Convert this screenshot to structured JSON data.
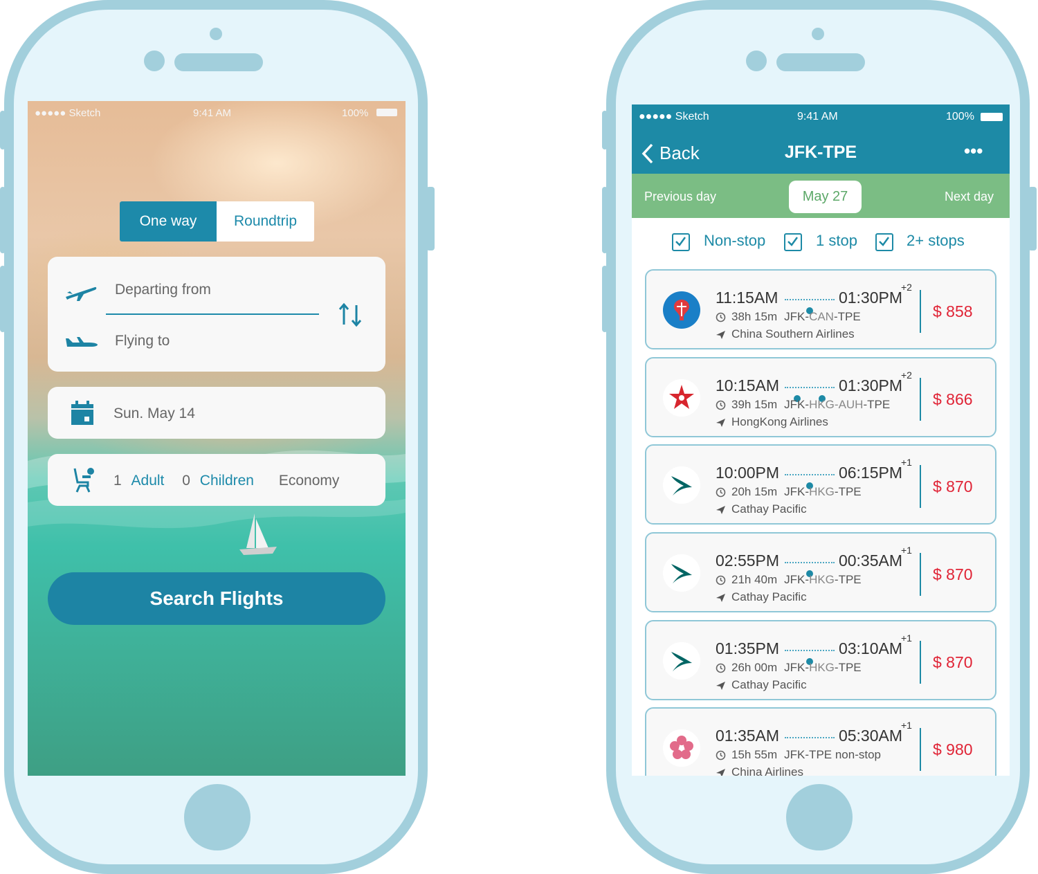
{
  "search_screen": {
    "status": {
      "carrier": "●●●●● Sketch",
      "time": "9:41 AM",
      "battery": "100%"
    },
    "trip_type": {
      "one_way": "One way",
      "roundtrip": "Roundtrip",
      "selected": "One way"
    },
    "route": {
      "departing_placeholder": "Departing from",
      "arriving_placeholder": "Flying to"
    },
    "date": "Sun. May 14",
    "passengers": {
      "adult_count": "1",
      "adult_label": "Adult",
      "children_count": "0",
      "children_label": "Children",
      "cabin": "Economy"
    },
    "search_button": "Search Flights"
  },
  "results_screen": {
    "status": {
      "carrier": "●●●●● Sketch",
      "time": "9:41 AM",
      "battery": "100%"
    },
    "nav": {
      "back": "Back",
      "title": "JFK-TPE",
      "more": "•••"
    },
    "day_nav": {
      "previous": "Previous day",
      "current": "May 27",
      "next": "Next day"
    },
    "filters": [
      {
        "label": "Non-stop",
        "checked": true
      },
      {
        "label": "1 stop",
        "checked": true
      },
      {
        "label": "2+ stops",
        "checked": true
      }
    ],
    "flights": [
      {
        "depart": "11:15AM",
        "arrive": "01:30PM",
        "day_offset": "+2",
        "duration": "38h 15m",
        "route_a": "JFK-",
        "route_b": "CAN",
        "route_c": "-TPE",
        "airline": "China Southern Airlines",
        "price": "$ 858",
        "stops": 1,
        "logo": "china-southern-logo"
      },
      {
        "depart": "10:15AM",
        "arrive": "01:30PM",
        "day_offset": "+2",
        "duration": "39h 15m",
        "route_a": "JFK-",
        "route_b": "HKG-AUH",
        "route_c": "-TPE",
        "airline": "HongKong Airlines",
        "price": "$ 866",
        "stops": 2,
        "logo": "hongkong-airlines-logo"
      },
      {
        "depart": "10:00PM",
        "arrive": "06:15PM",
        "day_offset": "+1",
        "duration": "20h 15m",
        "route_a": "JFK-",
        "route_b": "HKG",
        "route_c": "-TPE",
        "airline": "Cathay Pacific",
        "price": "$ 870",
        "stops": 1,
        "logo": "cathay-pacific-logo"
      },
      {
        "depart": "02:55PM",
        "arrive": "00:35AM",
        "day_offset": "+1",
        "duration": "21h 40m",
        "route_a": "JFK-",
        "route_b": "HKG",
        "route_c": "-TPE",
        "airline": "Cathay Pacific",
        "price": "$ 870",
        "stops": 1,
        "logo": "cathay-pacific-logo"
      },
      {
        "depart": "01:35PM",
        "arrive": "03:10AM",
        "day_offset": "+1",
        "duration": "26h 00m",
        "route_a": "JFK-",
        "route_b": "HKG",
        "route_c": "-TPE",
        "airline": "Cathay Pacific",
        "price": "$ 870",
        "stops": 1,
        "logo": "cathay-pacific-logo"
      },
      {
        "depart": "01:35AM",
        "arrive": "05:30AM",
        "day_offset": "+1",
        "duration": "15h 55m",
        "route_a": "JFK-TPE non-stop",
        "route_b": "",
        "route_c": "",
        "airline": "China Airlines",
        "price": "$ 980",
        "stops": 0,
        "logo": "china-airlines-logo"
      }
    ]
  },
  "colors": {
    "frame": "#a2cfdc",
    "accent": "#1d8aa6",
    "green_bar": "#7bbd84",
    "price": "#e02436"
  }
}
